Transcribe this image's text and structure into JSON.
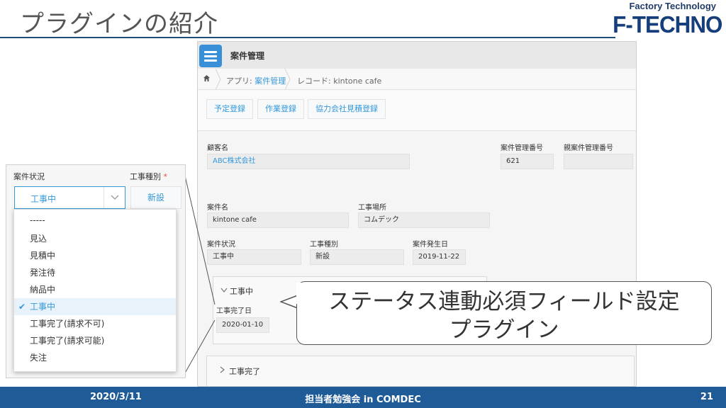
{
  "slide": {
    "title": "プラグインの紹介",
    "brand_top": "Factory Technology",
    "brand_logo": "F-TECHNO"
  },
  "app": {
    "title": "案件管理",
    "breadcrumb": {
      "app_prefix": "アプリ: ",
      "app_name": "案件管理",
      "record": "レコード: kintone cafe"
    },
    "toolbar": [
      "予定登録",
      "作業登録",
      "協力会社見積登録"
    ],
    "fields": {
      "customer_label": "顧客名",
      "customer_value": "ABC株式会社",
      "mgmt_no_label": "案件管理番号",
      "mgmt_no_value": "621",
      "parent_no_label": "親案件管理番号",
      "parent_no_value": "",
      "case_name_label": "案件名",
      "case_name_value": "kintone cafe",
      "site_label": "工事場所",
      "site_value": "コムデック",
      "status_label": "案件状況",
      "status_value": "工事中",
      "type_label": "工事種別",
      "type_value": "新設",
      "date_label": "案件発生日",
      "date_value": "2019-11-22"
    },
    "group_in_progress": {
      "title": "工事中",
      "done_date_label": "工事完了日",
      "done_date_value": "2020-01-10"
    },
    "group_completed": {
      "title": "工事完了"
    }
  },
  "callout": {
    "line1": "ステータス連動必須フィールド設定",
    "line2": "プラグイン"
  },
  "zoom": {
    "status_label": "案件状況",
    "type_label": "工事種別",
    "required_mark": "*",
    "selected": "工事中",
    "type_button": "新設",
    "options": [
      "-----",
      "見込",
      "見積中",
      "発注待",
      "納品中",
      "工事中",
      "工事完了(請求不可)",
      "工事完了(請求可能)",
      "失注"
    ],
    "check_mark": "✔"
  },
  "footer": {
    "date": "2020/3/11",
    "event": "担当者勉強会 in COMDEC",
    "page": "21"
  },
  "colors": {
    "accent": "#3498db",
    "footer_bg": "#1e5b97",
    "brand": "#163e7a"
  }
}
